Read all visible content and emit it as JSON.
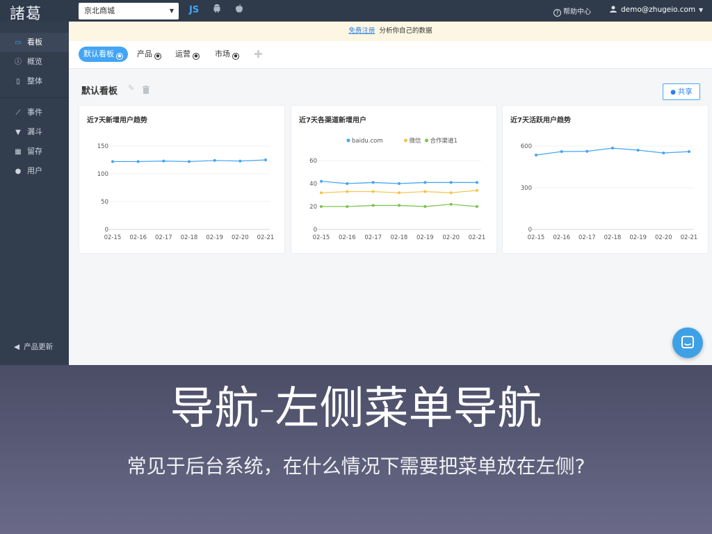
{
  "topbar": {
    "logo": "諸葛",
    "project_select": "京北商城",
    "js_label": "JS",
    "help": "帮助中心",
    "user_email": "demo@zhugeio.com"
  },
  "sidebar": {
    "items": [
      {
        "label": "看板",
        "icon": "dashboard-icon"
      },
      {
        "label": "概览",
        "icon": "info-icon"
      },
      {
        "label": "整体",
        "icon": "tablet-icon"
      },
      {
        "label": "事件",
        "icon": "line-chart-icon"
      },
      {
        "label": "漏斗",
        "icon": "funnel-icon"
      },
      {
        "label": "留存",
        "icon": "grid-icon"
      },
      {
        "label": "用户",
        "icon": "user-icon"
      }
    ],
    "update": "产品更新"
  },
  "notice": {
    "link": "免费注册",
    "text": "分析你自己的数据"
  },
  "tabs": [
    "默认看板",
    "产品",
    "运营",
    "市场"
  ],
  "board": {
    "title": "默认看板",
    "share": "共享"
  },
  "colors": {
    "accent": "#42a5f5",
    "green": "#7cc34b",
    "yellow": "#f5c342"
  },
  "chart_data": [
    {
      "type": "line",
      "title": "近7天新增用户趋势",
      "x": [
        "02-15",
        "02-16",
        "02-17",
        "02-18",
        "02-19",
        "02-20",
        "02-21"
      ],
      "series": [
        {
          "values": [
            122,
            122,
            123,
            122,
            124,
            123,
            125
          ],
          "color": "#42a5f5"
        }
      ],
      "ylim": [
        0,
        150
      ],
      "yticks": [
        0,
        50,
        100,
        150
      ],
      "grid": true
    },
    {
      "type": "line",
      "title": "近7天各渠道新增用户",
      "x": [
        "02-15",
        "02-16",
        "02-17",
        "02-18",
        "02-19",
        "02-20",
        "02-21"
      ],
      "series": [
        {
          "name": "baidu.com",
          "values": [
            42,
            40,
            41,
            40,
            41,
            41,
            41
          ],
          "color": "#42a5f5"
        },
        {
          "name": "微信",
          "values": [
            32,
            33,
            33,
            32,
            33,
            32,
            34
          ],
          "color": "#f5c342"
        },
        {
          "name": "合作渠道1",
          "values": [
            20,
            20,
            21,
            21,
            20,
            22,
            20
          ],
          "color": "#7cc34b"
        }
      ],
      "ylim": [
        0,
        60
      ],
      "yticks": [
        0,
        20,
        40,
        60
      ],
      "legend": "top",
      "grid": true
    },
    {
      "type": "line",
      "title": "近7天活跃用户趋势",
      "x": [
        "02-15",
        "02-16",
        "02-17",
        "02-18",
        "02-19",
        "02-20",
        "02-21"
      ],
      "series": [
        {
          "values": [
            535,
            560,
            562,
            585,
            570,
            550,
            560
          ],
          "color": "#42a5f5"
        }
      ],
      "ylim": [
        0,
        600
      ],
      "yticks": [
        0,
        300,
        600
      ],
      "grid": true
    }
  ],
  "overlay": {
    "title": "导航-左侧菜单导航",
    "subtitle": "常见于后台系统，在什么情况下需要把菜单放在左侧?"
  }
}
